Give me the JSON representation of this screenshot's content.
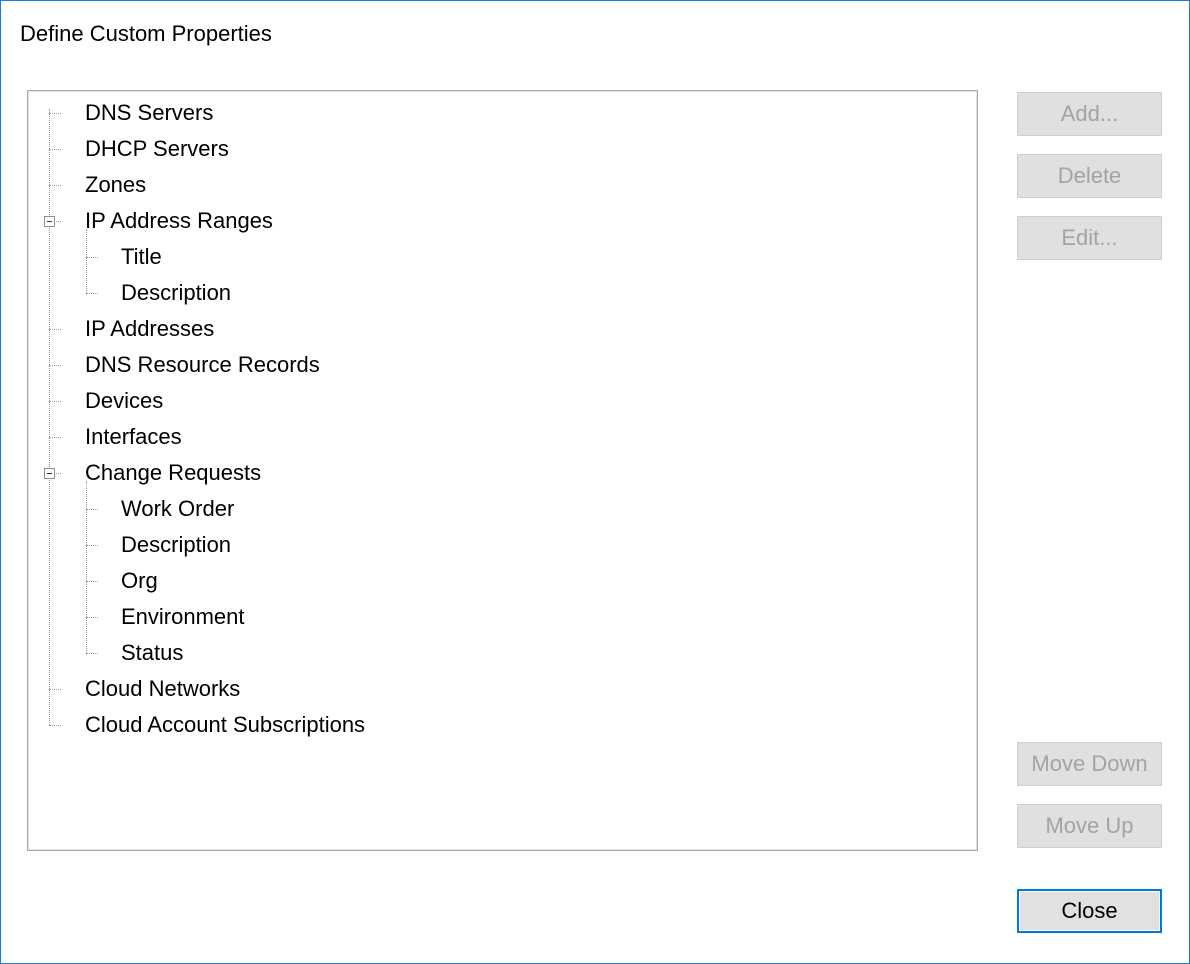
{
  "dialog": {
    "title": "Define Custom Properties"
  },
  "tree": {
    "items": [
      {
        "label": "DNS Servers",
        "level": 0,
        "expanded": false
      },
      {
        "label": "DHCP Servers",
        "level": 0,
        "expanded": false
      },
      {
        "label": "Zones",
        "level": 0,
        "expanded": false
      },
      {
        "label": "IP Address Ranges",
        "level": 0,
        "expanded": true
      },
      {
        "label": "Title",
        "level": 1
      },
      {
        "label": "Description",
        "level": 1
      },
      {
        "label": "IP Addresses",
        "level": 0,
        "expanded": false
      },
      {
        "label": "DNS Resource Records",
        "level": 0,
        "expanded": false
      },
      {
        "label": "Devices",
        "level": 0,
        "expanded": false
      },
      {
        "label": "Interfaces",
        "level": 0,
        "expanded": false
      },
      {
        "label": "Change Requests",
        "level": 0,
        "expanded": true
      },
      {
        "label": "Work Order",
        "level": 1
      },
      {
        "label": "Description",
        "level": 1
      },
      {
        "label": "Org",
        "level": 1
      },
      {
        "label": "Environment",
        "level": 1
      },
      {
        "label": "Status",
        "level": 1
      },
      {
        "label": "Cloud Networks",
        "level": 0,
        "expanded": false
      },
      {
        "label": "Cloud Account Subscriptions",
        "level": 0,
        "expanded": false
      }
    ]
  },
  "buttons": {
    "add": {
      "label": "Add...",
      "enabled": false
    },
    "delete": {
      "label": "Delete",
      "enabled": false
    },
    "edit": {
      "label": "Edit...",
      "enabled": false
    },
    "move_down": {
      "label": "Move Down",
      "enabled": false
    },
    "move_up": {
      "label": "Move Up",
      "enabled": false
    },
    "close": {
      "label": "Close",
      "enabled": true
    }
  },
  "colors": {
    "window_border": "#1a7fd6",
    "disabled_text": "#a3a3a3",
    "default_button_border": "#0078d7"
  }
}
